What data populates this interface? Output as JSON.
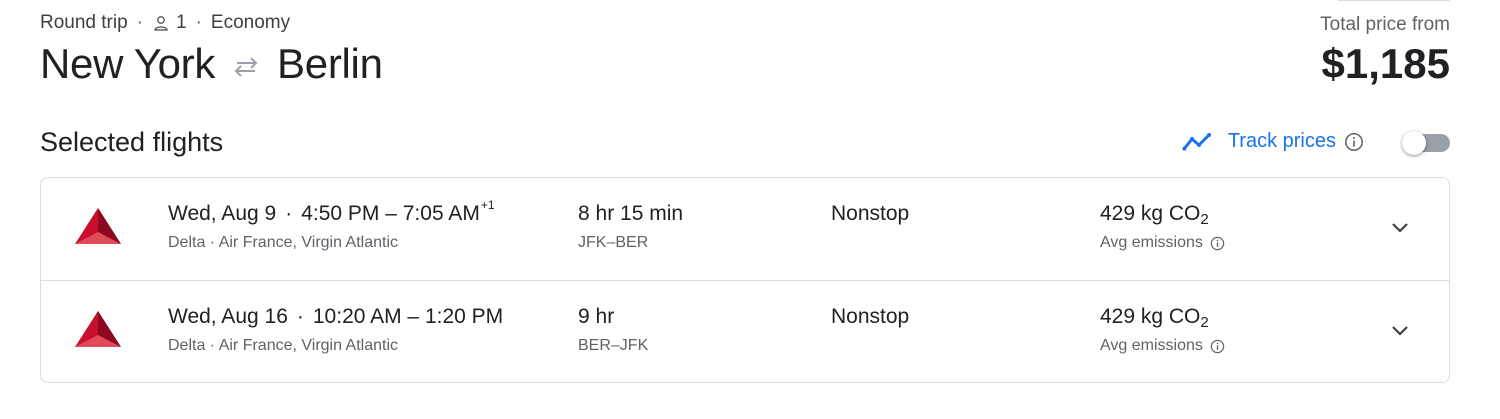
{
  "header": {
    "trip_type": "Round trip",
    "passengers": "1",
    "cabin_class": "Economy",
    "separator": "·",
    "origin": "New York",
    "destination": "Berlin",
    "total_label": "Total price from",
    "total_price": "$1,185"
  },
  "selected_flights": {
    "title": "Selected flights",
    "track_prices_label": "Track prices",
    "track_prices_enabled": false
  },
  "flights": [
    {
      "date": "Wed, Aug 9",
      "separator": "·",
      "times": "4:50 PM – 7:05 AM",
      "day_offset": "+1",
      "carriers": "Delta · Air France, Virgin Atlantic",
      "duration": "8 hr 15 min",
      "airports": "JFK–BER",
      "stops": "Nonstop",
      "co2_value": "429 kg CO",
      "co2_sub": "2",
      "emissions_label": "Avg emissions"
    },
    {
      "date": "Wed, Aug 16",
      "separator": "·",
      "times": "10:20 AM – 1:20 PM",
      "day_offset": "",
      "carriers": "Delta · Air France, Virgin Atlantic",
      "duration": "9 hr",
      "airports": "BER–JFK",
      "stops": "Nonstop",
      "co2_value": "429 kg CO",
      "co2_sub": "2",
      "emissions_label": "Avg emissions"
    }
  ],
  "icons": {
    "person": "person-icon",
    "swap": "swap-arrows-icon",
    "trend": "trending-line-icon",
    "info": "info-icon",
    "airline_logo": "delta-logo-icon",
    "chevron": "chevron-down-icon"
  },
  "colors": {
    "accent": "#1a73e8",
    "delta_red": "#c8102e",
    "text_primary": "#202124",
    "text_secondary": "#5f6368",
    "border": "#dadce0"
  }
}
